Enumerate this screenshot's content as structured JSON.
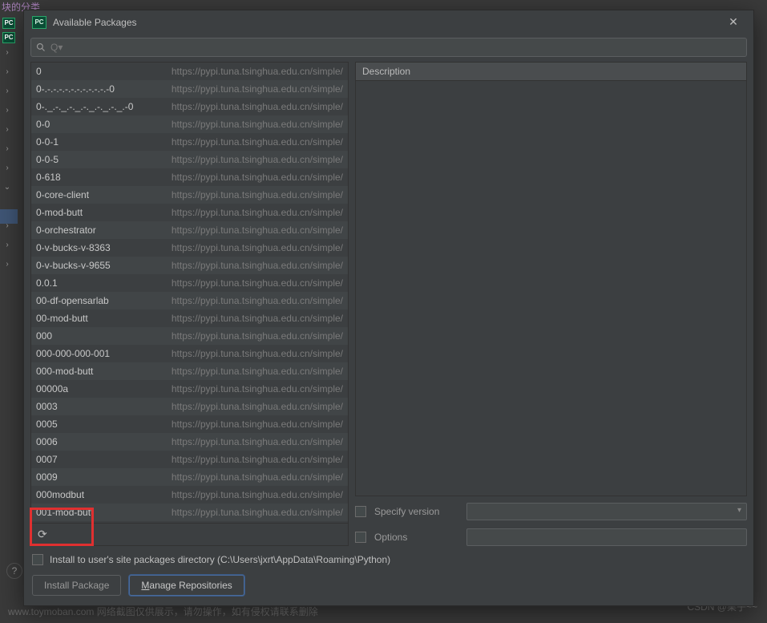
{
  "background": {
    "heading": "块的分类",
    "watermark": "CSDN @栗子~~",
    "faded": "www.toymoban.com 网络截图仅供展示，请勿操作，如有侵权请联系删除",
    "app_badge": "PC",
    "help_icon": "?"
  },
  "dialog": {
    "title": "Available Packages",
    "app_badge": "PC",
    "search_placeholder": "Q▾",
    "description_label": "Description",
    "specify_version_label": "Specify version",
    "options_label": "Options",
    "install_site_label": "Install to user's site packages directory (C:\\Users\\jxrt\\AppData\\Roaming\\Python)",
    "install_button": "Install Package",
    "manage_button_prefix": "M",
    "manage_button_rest": "anage Repositories"
  },
  "packages": [
    {
      "name": "0",
      "url": "https://pypi.tuna.tsinghua.edu.cn/simple/"
    },
    {
      "name": "0-.-.-.-.-.-.-.-.-.-.-.-0",
      "url": "https://pypi.tuna.tsinghua.edu.cn/simple/"
    },
    {
      "name": "0-._.-._.-._.-._.-._.-._.-0",
      "url": "https://pypi.tuna.tsinghua.edu.cn/simple/"
    },
    {
      "name": "0-0",
      "url": "https://pypi.tuna.tsinghua.edu.cn/simple/"
    },
    {
      "name": "0-0-1",
      "url": "https://pypi.tuna.tsinghua.edu.cn/simple/"
    },
    {
      "name": "0-0-5",
      "url": "https://pypi.tuna.tsinghua.edu.cn/simple/"
    },
    {
      "name": "0-618",
      "url": "https://pypi.tuna.tsinghua.edu.cn/simple/"
    },
    {
      "name": "0-core-client",
      "url": "https://pypi.tuna.tsinghua.edu.cn/simple/"
    },
    {
      "name": "0-mod-butt",
      "url": "https://pypi.tuna.tsinghua.edu.cn/simple/"
    },
    {
      "name": "0-orchestrator",
      "url": "https://pypi.tuna.tsinghua.edu.cn/simple/"
    },
    {
      "name": "0-v-bucks-v-8363",
      "url": "https://pypi.tuna.tsinghua.edu.cn/simple/"
    },
    {
      "name": "0-v-bucks-v-9655",
      "url": "https://pypi.tuna.tsinghua.edu.cn/simple/"
    },
    {
      "name": "0.0.1",
      "url": "https://pypi.tuna.tsinghua.edu.cn/simple/"
    },
    {
      "name": "00-df-opensarlab",
      "url": "https://pypi.tuna.tsinghua.edu.cn/simple/"
    },
    {
      "name": "00-mod-butt",
      "url": "https://pypi.tuna.tsinghua.edu.cn/simple/"
    },
    {
      "name": "000",
      "url": "https://pypi.tuna.tsinghua.edu.cn/simple/"
    },
    {
      "name": "000-000-000-001",
      "url": "https://pypi.tuna.tsinghua.edu.cn/simple/"
    },
    {
      "name": "000-mod-butt",
      "url": "https://pypi.tuna.tsinghua.edu.cn/simple/"
    },
    {
      "name": "00000a",
      "url": "https://pypi.tuna.tsinghua.edu.cn/simple/"
    },
    {
      "name": "0003",
      "url": "https://pypi.tuna.tsinghua.edu.cn/simple/"
    },
    {
      "name": "0005",
      "url": "https://pypi.tuna.tsinghua.edu.cn/simple/"
    },
    {
      "name": "0006",
      "url": "https://pypi.tuna.tsinghua.edu.cn/simple/"
    },
    {
      "name": "0007",
      "url": "https://pypi.tuna.tsinghua.edu.cn/simple/"
    },
    {
      "name": "0009",
      "url": "https://pypi.tuna.tsinghua.edu.cn/simple/"
    },
    {
      "name": "000modbut",
      "url": "https://pypi.tuna.tsinghua.edu.cn/simple/"
    },
    {
      "name": "001-mod-butt",
      "url": "https://pypi.tuna.tsinghua.edu.cn/simple/"
    }
  ]
}
